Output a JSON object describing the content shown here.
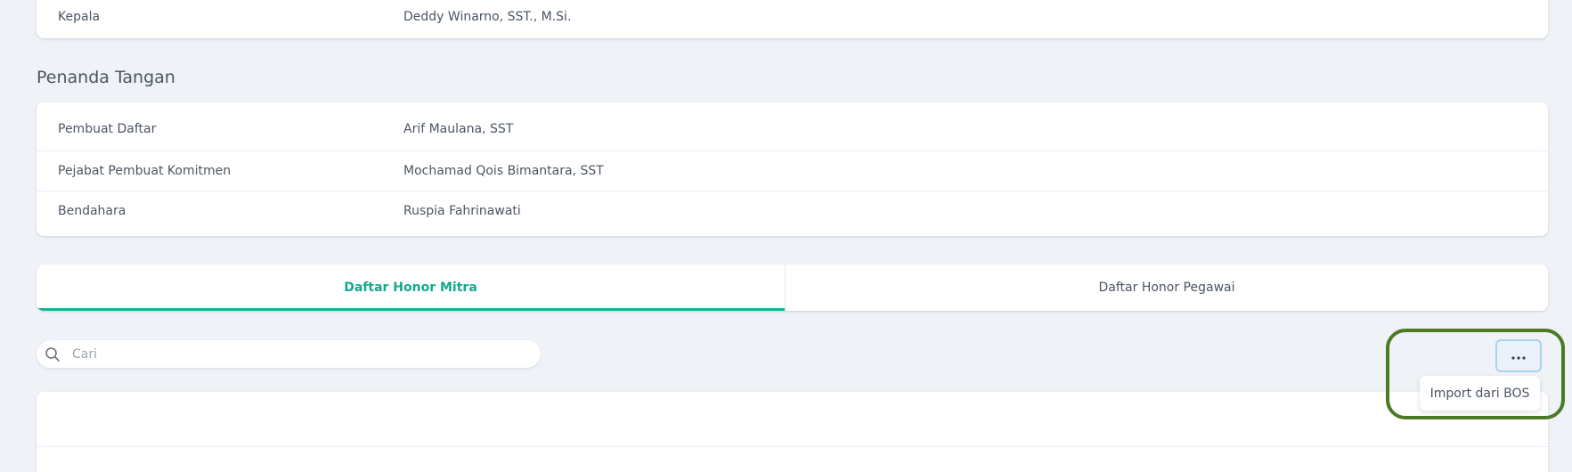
{
  "unit_info": {
    "rows": [
      {
        "label": "Kepala",
        "value": "Deddy Winarno, SST., M.Si."
      }
    ]
  },
  "signatories": {
    "title": "Penanda Tangan",
    "rows": [
      {
        "label": "Pembuat Daftar",
        "value": "Arif Maulana, SST"
      },
      {
        "label": "Pejabat Pembuat Komitmen",
        "value": "Mochamad Qois Bimantara, SST"
      },
      {
        "label": "Bendahara",
        "value": "Ruspia Fahrinawati"
      }
    ]
  },
  "tabs": [
    {
      "label": "Daftar Honor Mitra",
      "active": true
    },
    {
      "label": "Daftar Honor Pegawai",
      "active": false
    }
  ],
  "search": {
    "placeholder": "Cari",
    "value": "",
    "icon": "search-icon"
  },
  "actions": {
    "more_icon": "more-horizontal-icon",
    "menu_items": [
      {
        "label": "Import dari BOS"
      }
    ]
  },
  "colors": {
    "accent": "#14b394",
    "background": "#eff2f7",
    "highlight": "#4a7a23"
  }
}
